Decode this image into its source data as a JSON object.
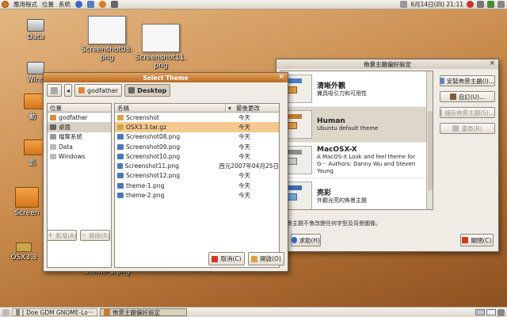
{
  "top_panel": {
    "menus": [
      "應用程式",
      "位置",
      "系統"
    ],
    "clock": "6月14日(四) 21:11"
  },
  "desktop_icons": [
    {
      "name": "data-drive",
      "label": "Data"
    },
    {
      "name": "windows-drive",
      "label": "Wind"
    },
    {
      "name": "screenshot08-file",
      "label": "Screenshot08.\npng"
    },
    {
      "name": "screenshot11-file",
      "label": "Screenshot11.\npng"
    },
    {
      "name": "folder-1",
      "label": "動"
    },
    {
      "name": "folder-2",
      "label": "影"
    },
    {
      "name": "screen-folder",
      "label": "Screen"
    },
    {
      "name": "osx-file",
      "label": "OSX3.3"
    },
    {
      "name": "theme1-file",
      "label": "theme-1.png"
    }
  ],
  "select_theme": {
    "title": "Select Theme",
    "path_buttons": [
      "godfather",
      "Desktop"
    ],
    "places_header": "位置",
    "places": [
      "godfather",
      "桌面",
      "檔案系統",
      "Data",
      "Windows"
    ],
    "col_name": "名稱",
    "col_modified": "最後更改",
    "files": [
      {
        "name": "Screenshot",
        "date": "今天",
        "type": "folder"
      },
      {
        "name": "OSX3.3.tar.gz",
        "date": "今天",
        "type": "archive"
      },
      {
        "name": "Screenshot08.png",
        "date": "今天",
        "type": "image"
      },
      {
        "name": "Screenshot09.png",
        "date": "今天",
        "type": "image"
      },
      {
        "name": "Screenshot10.png",
        "date": "今天",
        "type": "image"
      },
      {
        "name": "Screenshot11.png",
        "date": "西元2007年04月25日",
        "type": "image"
      },
      {
        "name": "Screenshot12.png",
        "date": "今天",
        "type": "image"
      },
      {
        "name": "theme-1.png",
        "date": "今天",
        "type": "image"
      },
      {
        "name": "theme-2.png",
        "date": "今天",
        "type": "image"
      }
    ],
    "add_label": "新增(A)",
    "remove_label": "移除(R)",
    "cancel_label": "取消(C)",
    "open_label": "開啟(O)"
  },
  "prefs": {
    "title": "佈景主題偏好設定",
    "themes": [
      {
        "name": "清晰外觀",
        "desc": "兼具吸引力和可用性"
      },
      {
        "name": "Human",
        "desc": "Ubuntu default theme"
      },
      {
        "name": "MacOSX-X",
        "desc": "A MacOS-X Look and feel theme for G··· Authors: Danny Wu and Steven Young"
      },
      {
        "name": "亮彩",
        "desc": "外觀光亮的佈景主題"
      }
    ],
    "install_label": "安裝佈景主題(I)...",
    "customize_label": "自訂(U)...",
    "save_label": "儲存佈景主題(S)...",
    "revert_label": "還原(R)",
    "footer_note": "佈景主題不會改變任何字型及背景圖像。",
    "help_label": "求助(H)",
    "close_label": "關閉(C)"
  },
  "taskbar": {
    "tasks": [
      "[ Doe GDM GNOME-Lo···",
      "佈景主題偏好設定"
    ]
  }
}
